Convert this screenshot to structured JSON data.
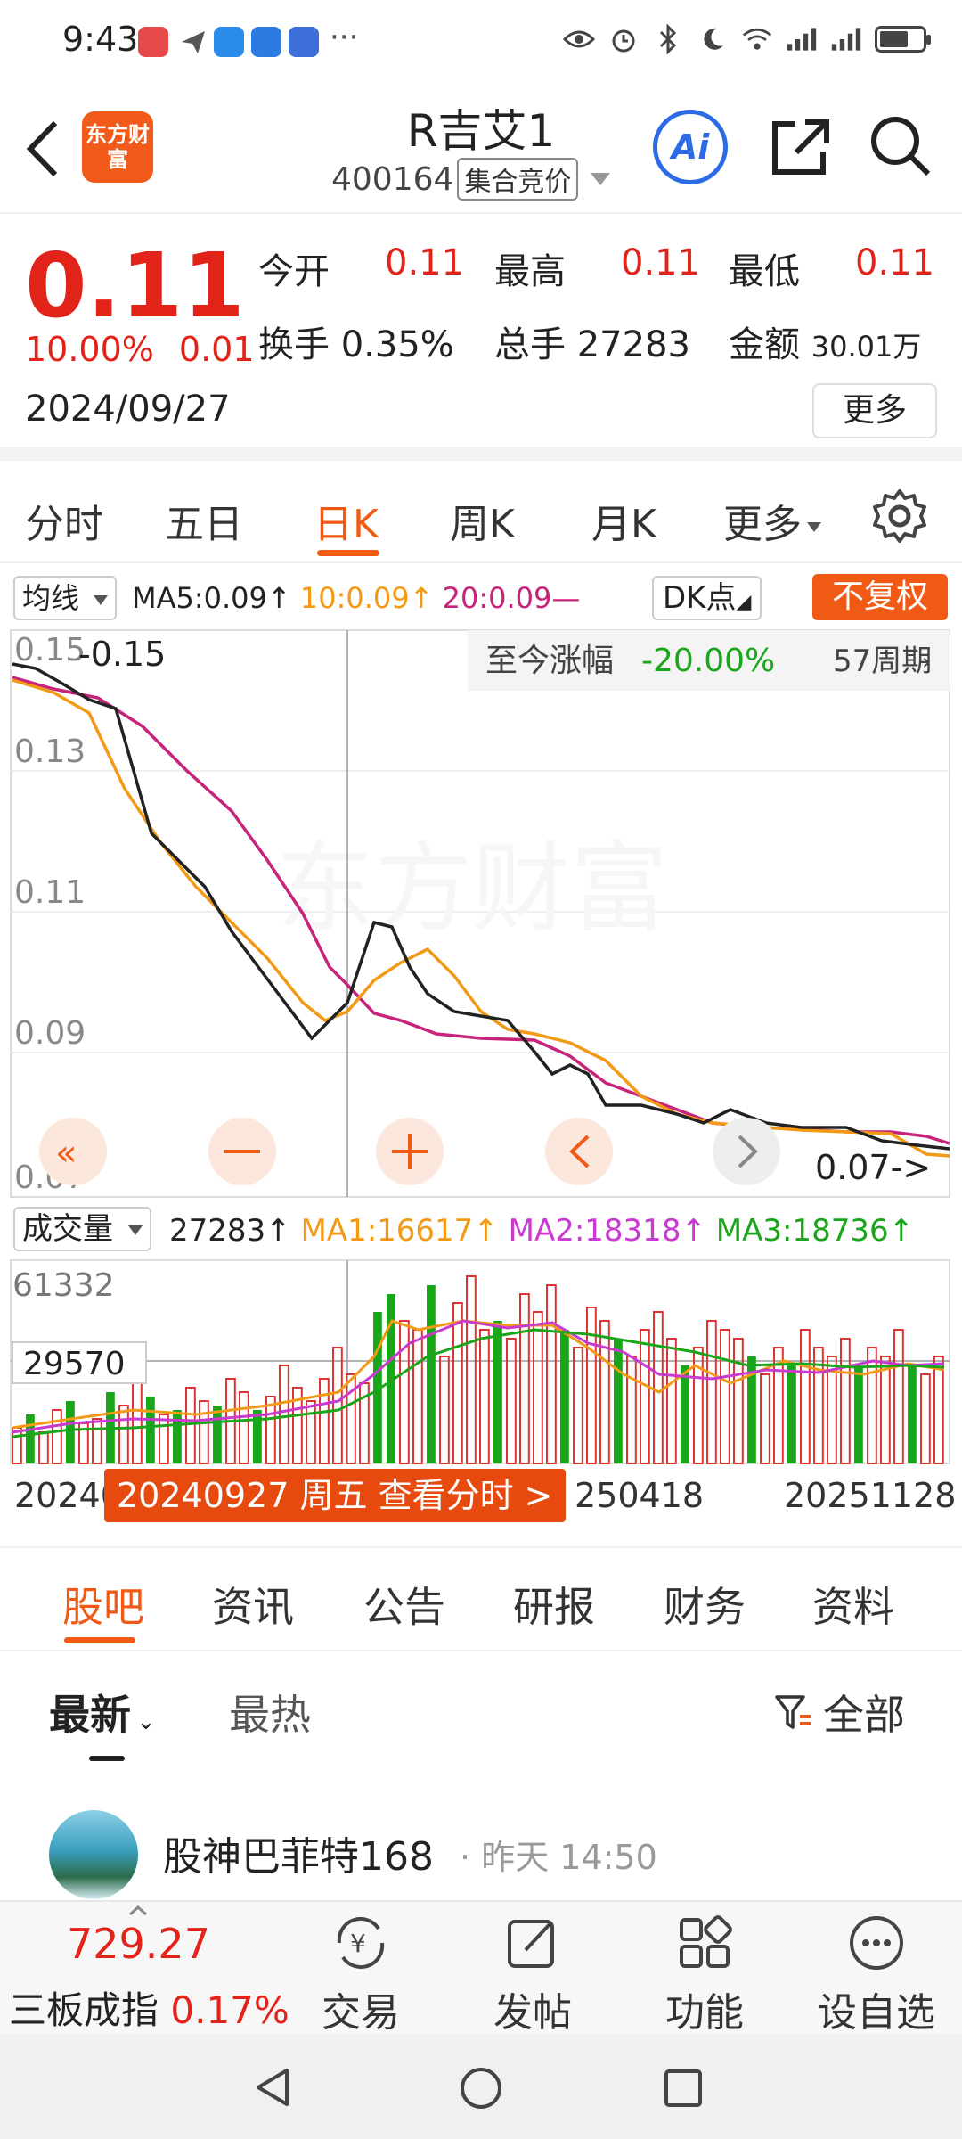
{
  "status_bar": {
    "time": "9:43",
    "more": "···"
  },
  "header": {
    "logo_text": "东方财富",
    "stock_name": "R吉艾1",
    "stock_code": "400164",
    "auction_tag": "集合竞价"
  },
  "quote": {
    "price": "0.11",
    "change_pct": "10.00%",
    "change_amt": "0.01",
    "date": "2024/09/27",
    "open_label": "今开",
    "open": "0.11",
    "high_label": "最高",
    "high": "0.11",
    "low_label": "最低",
    "low": "0.11",
    "turnover_label": "换手",
    "turnover": "0.35%",
    "volume_label": "总手",
    "volume": "27283",
    "amount_label": "金额",
    "amount": "30.01万",
    "more_label": "更多"
  },
  "period_tabs": [
    "分时",
    "五日",
    "日K",
    "周K",
    "月K",
    "更多"
  ],
  "active_period": "日K",
  "ma_row": {
    "select_label": "均线",
    "ma5": "MA5:0.09↑",
    "ma10": "10:0.09↑",
    "ma20": "20:0.09—",
    "dk_label": "DK点",
    "fq_label": "不复权"
  },
  "kline": {
    "y_labels": [
      "0.15",
      "0.13",
      "0.11",
      "0.09",
      "0.07"
    ],
    "max_label": "0.15",
    "min_label": "0.07",
    "range_label": "至今涨幅",
    "range_value": "-20.00%",
    "range_period": "57周期",
    "watermark": "东方财富",
    "colors": {
      "ma5": "#222222",
      "ma10": "#f29a16",
      "ma20": "#c8237a",
      "up": "#e2231a",
      "down": "#1aa51a"
    }
  },
  "volume": {
    "select_label": "成交量",
    "value": "27283↑",
    "ma1": "MA1:16617↑",
    "ma2": "MA2:18318↑",
    "ma3": "MA3:18736↑",
    "y_max": "61332",
    "y_cross": "29570"
  },
  "x_axis": {
    "left": "20240",
    "mid": "250418",
    "right": "20251128"
  },
  "tooltip": "20240927 周五 查看分时 >",
  "section_tabs": [
    "股吧",
    "资讯",
    "公告",
    "研报",
    "财务",
    "资料"
  ],
  "sort": {
    "newest": "最新",
    "hottest": "最热",
    "filter": "全部"
  },
  "post": {
    "user": "股神巴菲特168",
    "dot": "·",
    "time": "昨天 14:50"
  },
  "bottom_bar": {
    "index_value": "729.27",
    "index_name": "三板成指",
    "index_pct": "0.17%",
    "trade": "交易",
    "post": "发帖",
    "functions": "功能",
    "watchlist": "设自选"
  }
}
